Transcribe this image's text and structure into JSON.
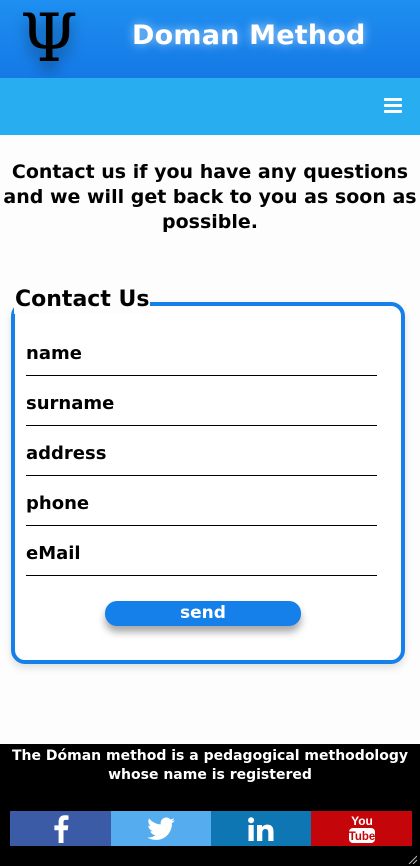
{
  "header": {
    "logo_symbol": "Ψ",
    "title": "Doman Method",
    "background_color": "#1579e6"
  },
  "navbar": {
    "background_color": "#28aef0",
    "menu_icon": "hamburger-menu-icon"
  },
  "intro": {
    "line1": "Contact us if you have any questions",
    "line2": "and we will get back to you as soon as",
    "line3": "possible."
  },
  "contact_form": {
    "legend": "Contact Us",
    "fields": [
      {
        "placeholder": "name",
        "value": ""
      },
      {
        "placeholder": "surname",
        "value": ""
      },
      {
        "placeholder": "address",
        "value": ""
      },
      {
        "placeholder": "phone",
        "value": ""
      },
      {
        "placeholder": "eMail",
        "value": ""
      }
    ],
    "send_label": "send",
    "accent_color": "#1580ea"
  },
  "footer": {
    "line1": "The Dóman method is a pedagogical methodology",
    "line2": "whose name is registered",
    "social": [
      {
        "icon": "facebook-icon",
        "color": "#3b5ba6"
      },
      {
        "icon": "twitter-icon",
        "color": "#55acee"
      },
      {
        "icon": "linkedin-icon",
        "color": "#0e76b3"
      },
      {
        "icon": "youtube-icon",
        "color": "#c4060a"
      }
    ]
  }
}
